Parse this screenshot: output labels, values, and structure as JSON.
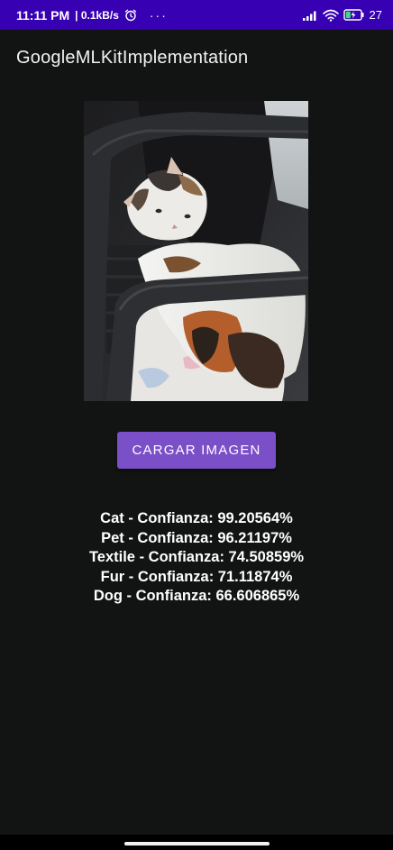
{
  "status_bar": {
    "time": "11:11 PM",
    "speed": "0.1kB/s",
    "more": "···",
    "battery": "27"
  },
  "app_bar": {
    "title": "GoogleMLKitImplementation"
  },
  "main": {
    "button_label": "CARGAR IMAGEN",
    "results": [
      "Cat - Confianza: 99.20564%",
      "Pet - Confianza: 96.21197%",
      "Textile - Confianza: 74.50859%",
      "Fur - Confianza: 71.11874%",
      "Dog - Confianza: 66.606865%"
    ]
  },
  "colors": {
    "status_bar": "#3700b3",
    "background": "#121413",
    "button": "#7b4fc7"
  },
  "icons": [
    "alarm-icon",
    "signal-icon",
    "wifi-icon",
    "battery-charging-icon"
  ]
}
